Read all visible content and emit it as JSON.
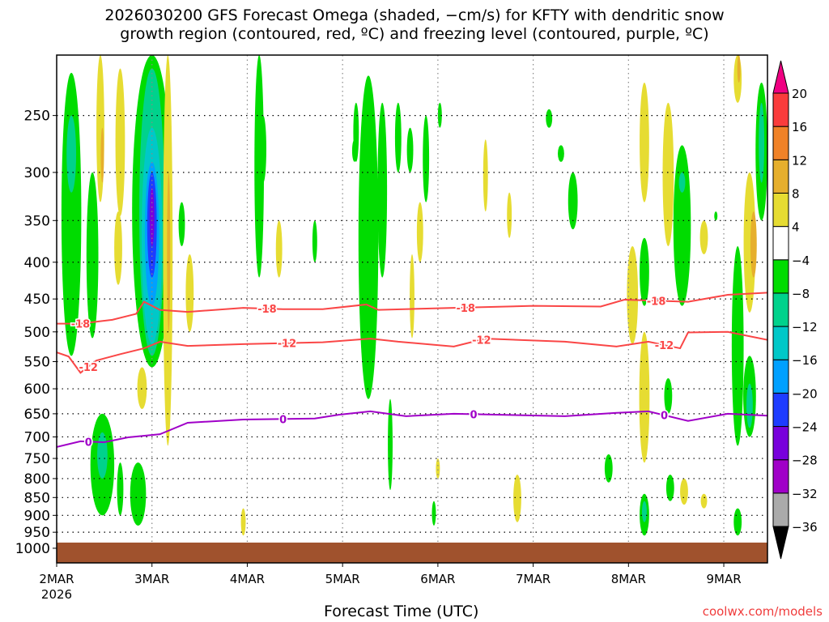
{
  "chart_data": {
    "type": "heatmap",
    "title_line1": "2026030200 GFS Forecast Omega (shaded, −cm/s) for KFTY with dendritic snow",
    "title_line2": "growth region (contoured, red, ºC) and freezing level (contoured, purple, ºC)",
    "xlabel": "Forecast Time (UTC)",
    "credit": "coolwx.com/models",
    "x_unit": "forecast hours",
    "xlim": [
      0,
      179
    ],
    "ylim_hPa": [
      206,
      1048
    ],
    "y_scale": "log",
    "x_ticks": [
      {
        "hour": 0,
        "label": "2MAR",
        "sub": "2026"
      },
      {
        "hour": 24,
        "label": "3MAR"
      },
      {
        "hour": 48,
        "label": "4MAR"
      },
      {
        "hour": 72,
        "label": "5MAR"
      },
      {
        "hour": 96,
        "label": "6MAR"
      },
      {
        "hour": 120,
        "label": "7MAR"
      },
      {
        "hour": 144,
        "label": "8MAR"
      },
      {
        "hour": 168,
        "label": "9MAR"
      }
    ],
    "y_ticks": [
      250,
      300,
      350,
      400,
      450,
      500,
      550,
      600,
      650,
      700,
      750,
      800,
      850,
      900,
      950,
      1000
    ],
    "surface_pressure_hPa": 982,
    "colorbar": {
      "levels": [
        -36,
        -32,
        -28,
        -24,
        -20,
        -16,
        -12,
        -8,
        -4,
        4,
        8,
        12,
        16,
        20
      ],
      "labels": [
        "−36",
        "−32",
        "−28",
        "−24",
        "−20",
        "−16",
        "−12",
        "−8",
        "−4",
        "4",
        "8",
        "12",
        "16",
        "20"
      ],
      "colors": [
        "#aaaaaa",
        "#a000c8",
        "#7800dc",
        "#1e3cff",
        "#00a0ff",
        "#00c8c8",
        "#00d28c",
        "#00dc00",
        "#ffffff",
        "#e6dc32",
        "#e6af2d",
        "#f08228",
        "#fa3c3c"
      ],
      "under_color": "#000000",
      "over_color": "#f00082"
    },
    "omega_blobs": [
      {
        "t": 3.7,
        "hw": 2.5,
        "p": [
          218,
          540
        ],
        "v": -6
      },
      {
        "t": 3.7,
        "hw": 1.2,
        "p": [
          250,
          320
        ],
        "v": -10
      },
      {
        "t": 9,
        "hw": 1.5,
        "p": [
          300,
          510
        ],
        "v": -6
      },
      {
        "t": 11,
        "hw": 1,
        "p": [
          206,
          330
        ],
        "v": 6
      },
      {
        "t": 11.5,
        "hw": 0.4,
        "p": [
          260,
          310
        ],
        "v": 10
      },
      {
        "t": 16,
        "hw": 1.2,
        "p": [
          215,
          345
        ],
        "v": 6
      },
      {
        "t": 15.5,
        "hw": 1,
        "p": [
          340,
          430
        ],
        "v": 6
      },
      {
        "t": 24,
        "hw": 5,
        "p": [
          206,
          560
        ],
        "v": -6
      },
      {
        "t": 24,
        "hw": 3.2,
        "p": [
          215,
          540
        ],
        "v": -10
      },
      {
        "t": 24,
        "hw": 2.6,
        "p": [
          260,
          520
        ],
        "v": -14
      },
      {
        "t": 24,
        "hw": 1.8,
        "p": [
          290,
          460
        ],
        "v": -18
      },
      {
        "t": 24,
        "hw": 1.2,
        "p": [
          300,
          420
        ],
        "v": -22
      },
      {
        "t": 24,
        "hw": 0.6,
        "p": [
          315,
          380
        ],
        "v": -26
      },
      {
        "t": 28,
        "hw": 1.2,
        "p": [
          206,
          720
        ],
        "v": 6
      },
      {
        "t": 28.2,
        "hw": 0.4,
        "p": [
          300,
          500
        ],
        "v": 10
      },
      {
        "t": 21.5,
        "hw": 1.2,
        "p": [
          560,
          640
        ],
        "v": 6
      },
      {
        "t": 11.5,
        "hw": 3,
        "p": [
          650,
          900
        ],
        "v": -6
      },
      {
        "t": 11.5,
        "hw": 1.3,
        "p": [
          690,
          800
        ],
        "v": -10
      },
      {
        "t": 20.5,
        "hw": 2,
        "p": [
          760,
          930
        ],
        "v": -6
      },
      {
        "t": 16,
        "hw": 0.8,
        "p": [
          760,
          900
        ],
        "v": -6
      },
      {
        "t": 33.5,
        "hw": 1,
        "p": [
          390,
          500
        ],
        "v": 6
      },
      {
        "t": 31.5,
        "hw": 0.8,
        "p": [
          330,
          380
        ],
        "v": -6
      },
      {
        "t": 51,
        "hw": 1.2,
        "p": [
          206,
          420
        ],
        "v": -6
      },
      {
        "t": 56,
        "hw": 0.8,
        "p": [
          350,
          420
        ],
        "v": 6
      },
      {
        "t": 47,
        "hw": 0.6,
        "p": [
          880,
          960
        ],
        "v": 6
      },
      {
        "t": 52,
        "hw": 0.8,
        "p": [
          250,
          310
        ],
        "v": -6
      },
      {
        "t": 65,
        "hw": 0.6,
        "p": [
          350,
          400
        ],
        "v": -6
      },
      {
        "t": 75,
        "hw": 0.6,
        "p": [
          270,
          290
        ],
        "v": -6
      },
      {
        "t": 75.4,
        "hw": 0.7,
        "p": [
          240,
          290
        ],
        "v": -6
      },
      {
        "t": 78.5,
        "hw": 2.5,
        "p": [
          220,
          620
        ],
        "v": -6
      },
      {
        "t": 82,
        "hw": 1.2,
        "p": [
          240,
          420
        ],
        "v": -6
      },
      {
        "t": 84,
        "hw": 0.6,
        "p": [
          620,
          830
        ],
        "v": -6
      },
      {
        "t": 86,
        "hw": 0.8,
        "p": [
          240,
          300
        ],
        "v": -6
      },
      {
        "t": 89,
        "hw": 0.8,
        "p": [
          260,
          300
        ],
        "v": -6
      },
      {
        "t": 93,
        "hw": 0.8,
        "p": [
          250,
          330
        ],
        "v": -6
      },
      {
        "t": 91.5,
        "hw": 0.8,
        "p": [
          330,
          400
        ],
        "v": 6
      },
      {
        "t": 89.5,
        "hw": 0.6,
        "p": [
          390,
          510
        ],
        "v": 6
      },
      {
        "t": 96.5,
        "hw": 0.5,
        "p": [
          240,
          260
        ],
        "v": -6
      },
      {
        "t": 96,
        "hw": 0.5,
        "p": [
          750,
          800
        ],
        "v": 6
      },
      {
        "t": 95,
        "hw": 0.5,
        "p": [
          860,
          930
        ],
        "v": -6
      },
      {
        "t": 108,
        "hw": 0.6,
        "p": [
          270,
          340
        ],
        "v": 6
      },
      {
        "t": 114,
        "hw": 0.6,
        "p": [
          320,
          370
        ],
        "v": 6
      },
      {
        "t": 116,
        "hw": 1,
        "p": [
          790,
          920
        ],
        "v": 6
      },
      {
        "t": 124,
        "hw": 0.8,
        "p": [
          245,
          260
        ],
        "v": -6
      },
      {
        "t": 127,
        "hw": 0.8,
        "p": [
          275,
          290
        ],
        "v": -6
      },
      {
        "t": 130,
        "hw": 1.2,
        "p": [
          300,
          360
        ],
        "v": -6
      },
      {
        "t": 148,
        "hw": 1.2,
        "p": [
          225,
          330
        ],
        "v": 6
      },
      {
        "t": 154,
        "hw": 1.4,
        "p": [
          240,
          380
        ],
        "v": 6
      },
      {
        "t": 157.5,
        "hw": 2.2,
        "p": [
          275,
          460
        ],
        "v": -6
      },
      {
        "t": 157.5,
        "hw": 0.8,
        "p": [
          300,
          320
        ],
        "v": -10
      },
      {
        "t": 163,
        "hw": 1,
        "p": [
          350,
          390
        ],
        "v": 6
      },
      {
        "t": 166,
        "hw": 0.4,
        "p": [
          340,
          350
        ],
        "v": -6
      },
      {
        "t": 145,
        "hw": 1.4,
        "p": [
          380,
          520
        ],
        "v": 6
      },
      {
        "t": 148,
        "hw": 1.2,
        "p": [
          370,
          460
        ],
        "v": -6
      },
      {
        "t": 148,
        "hw": 1.3,
        "p": [
          500,
          760
        ],
        "v": 6
      },
      {
        "t": 139,
        "hw": 1,
        "p": [
          740,
          810
        ],
        "v": -6
      },
      {
        "t": 148,
        "hw": 1.2,
        "p": [
          840,
          960
        ],
        "v": -6
      },
      {
        "t": 148,
        "hw": 0.6,
        "p": [
          860,
          920
        ],
        "v": -10
      },
      {
        "t": 154,
        "hw": 1,
        "p": [
          580,
          650
        ],
        "v": -6
      },
      {
        "t": 154.5,
        "hw": 1,
        "p": [
          790,
          860
        ],
        "v": -6
      },
      {
        "t": 158,
        "hw": 1,
        "p": [
          800,
          870
        ],
        "v": 6
      },
      {
        "t": 163,
        "hw": 0.8,
        "p": [
          840,
          880
        ],
        "v": 6
      },
      {
        "t": 171.5,
        "hw": 1,
        "p": [
          206,
          240
        ],
        "v": 6
      },
      {
        "t": 171.8,
        "hw": 0.4,
        "p": [
          206,
          225
        ],
        "v": 10
      },
      {
        "t": 174.5,
        "hw": 1.5,
        "p": [
          300,
          470
        ],
        "v": 6
      },
      {
        "t": 175.5,
        "hw": 0.8,
        "p": [
          340,
          420
        ],
        "v": 10
      },
      {
        "t": 171.5,
        "hw": 1.5,
        "p": [
          380,
          720
        ],
        "v": -6
      },
      {
        "t": 174.5,
        "hw": 1.6,
        "p": [
          540,
          700
        ],
        "v": -6
      },
      {
        "t": 174.5,
        "hw": 0.8,
        "p": [
          590,
          680
        ],
        "v": -10
      },
      {
        "t": 177.5,
        "hw": 1.5,
        "p": [
          225,
          350
        ],
        "v": -6
      },
      {
        "t": 177.5,
        "hw": 0.7,
        "p": [
          240,
          310
        ],
        "v": -10
      },
      {
        "t": 171.5,
        "hw": 1,
        "p": [
          880,
          960
        ],
        "v": -6
      }
    ],
    "contours": [
      {
        "name": "-18 ºC",
        "label": "-18",
        "color": "#fa4646",
        "label_hours": [
          6,
          53,
          103,
          151
        ],
        "t": [
          0,
          6,
          14,
          20,
          22,
          26,
          33,
          47,
          57,
          67,
          78,
          81,
          100,
          120,
          137,
          143,
          159,
          169,
          179
        ],
        "p": [
          487,
          487,
          481,
          472,
          454,
          466,
          469,
          463,
          465,
          465,
          458,
          466,
          463,
          460,
          461,
          451,
          454,
          444,
          441
        ]
      },
      {
        "name": "-12 ºC",
        "label": "-12",
        "color": "#fa4646",
        "label_hours": [
          8,
          58,
          107,
          153
        ],
        "t": [
          0,
          3,
          6,
          10,
          16,
          22,
          26,
          33,
          47,
          67,
          79,
          86,
          100,
          108,
          128,
          141,
          149,
          157,
          159,
          169,
          179
        ],
        "p": [
          534,
          541,
          570,
          548,
          537,
          527,
          516,
          523,
          520,
          517,
          511,
          516,
          524,
          511,
          516,
          524,
          516,
          527,
          501,
          500,
          513
        ]
      },
      {
        "name": "0 ºC",
        "label": "0",
        "color": "#a000c8",
        "label_hours": [
          8,
          57,
          105,
          153
        ],
        "t": [
          0,
          6,
          12,
          18,
          26,
          33,
          47,
          65,
          71,
          79,
          88,
          100,
          128,
          141,
          149,
          159,
          169,
          179
        ],
        "p": [
          723,
          710,
          712,
          701,
          694,
          669,
          662,
          660,
          652,
          645,
          655,
          650,
          655,
          648,
          645,
          665,
          650,
          654
        ]
      }
    ]
  }
}
